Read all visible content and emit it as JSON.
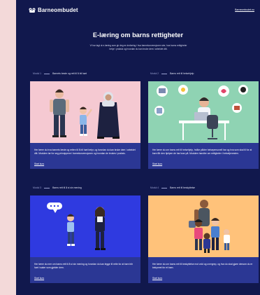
{
  "brand": {
    "name": "Barneombudet"
  },
  "nav": {
    "menu_label": "Barneombudet.no"
  },
  "hero": {
    "title": "E-læring om barns rettigheter",
    "intro": "Vi har lagt ut e-læring som gir deg en innføring i hva barnekonvensjonen sier, hva barns rettigheter betyr i praksis og hvordan du kan bruke dem i arbeidet ditt."
  },
  "modules": [
    {
      "number": "Modul 1",
      "title": "Barnets beste og rett til å bli hørt",
      "description": "Her lærer du hva barnets beste og retten til å bli hørt betyr, og hvordan du kan bruke dem i arbeidet ditt. Modulen tar for seg prinsippene i barnekonvensjonen og hvordan de brukes i praksis.",
      "cta": "Start kurs"
    },
    {
      "number": "Modul 2",
      "title": "Barns rett til helsehjelp",
      "description": "Her lærer du om barns rett til helsehjelp, hvilke plikter helsepersonell har og hva som skal til for at barn får den hjelpen de har krav på. Modulen handler om rettigheter i helsetjenesten.",
      "cta": "Start kurs"
    },
    {
      "number": "Modul 3",
      "title": "Barns rett til å si sin mening",
      "description": "Her lærer du mer om barns rett til å si sin mening og hvordan du kan legge til rette for at barn blir hørt i saker som gjelder dem.",
      "cta": "Start kurs"
    },
    {
      "number": "Modul 4",
      "title": "Barns rett til beskyttelse",
      "description": "Her lærer du om barns rett til beskyttelse mot vold og overgrep, og hva du skal gjøre dersom du er bekymret for et barn.",
      "cta": "Start kurs"
    }
  ],
  "icons": {
    "logo": "barneombudet-logo-icon",
    "speech": "speech-bubble-icon"
  },
  "colors": {
    "page_bg": "#11184d",
    "outer_bg": "#f3d9d9",
    "card_body": "#2b3794",
    "module1_bg": "#f5c9d2",
    "module2_bg": "#8fd3b3",
    "module3_bg": "#2f3ae0",
    "module4_bg": "#ffc27a"
  }
}
